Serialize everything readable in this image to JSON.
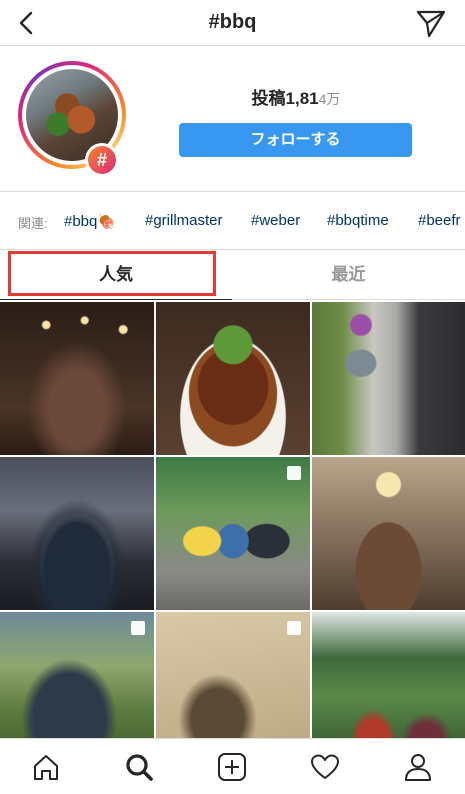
{
  "header": {
    "title": "#bbq",
    "back_icon": "chevron-left-icon",
    "share_icon": "paper-plane-icon"
  },
  "profile": {
    "posts_label": "投稿",
    "posts_count": "1,81",
    "posts_unit": "4万",
    "follow_label": "フォローする",
    "hash_symbol": "#"
  },
  "related": {
    "label": "関連:",
    "tags": [
      "#bbq🍖",
      "#grillmaster",
      "#weber",
      "#bbqtime",
      "#beefr"
    ]
  },
  "tabs": {
    "popular": "人気",
    "recent": "最近"
  },
  "grid": {
    "multi_photo_cells": [
      4,
      7,
      8
    ]
  },
  "bottom_nav": {
    "items": [
      "home-icon",
      "search-icon",
      "add-icon",
      "heart-icon",
      "profile-icon"
    ]
  },
  "colors": {
    "accent": "#3897f0",
    "highlight": "#e53935",
    "link": "#003569"
  }
}
